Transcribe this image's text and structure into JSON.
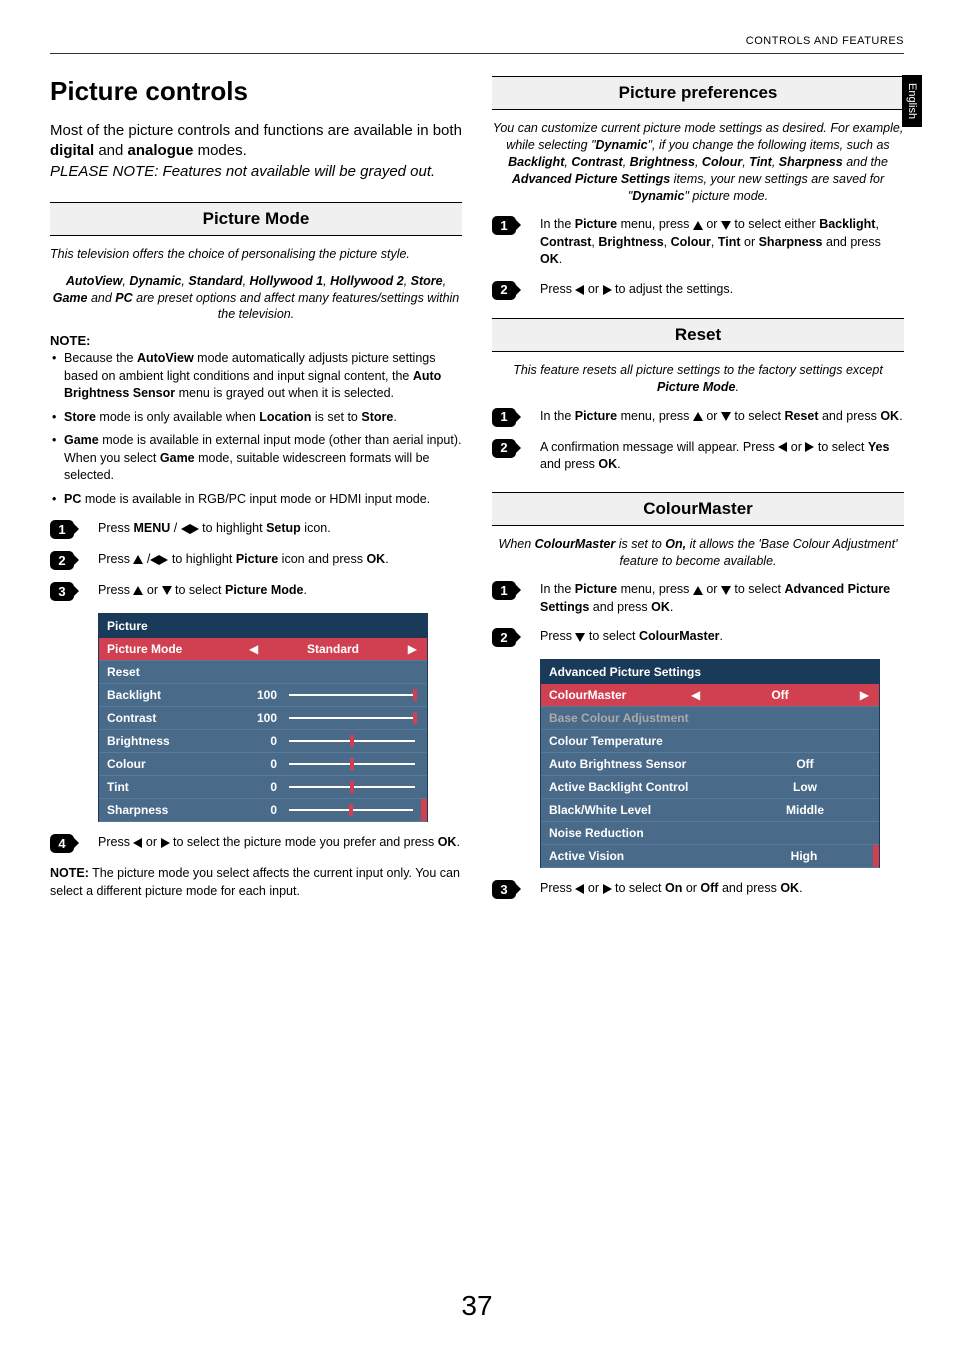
{
  "header": {
    "section_title": "CONTROLS AND FEATURES",
    "side_tab": "English"
  },
  "page_number": "37",
  "left": {
    "h1": "Picture controls",
    "intro_1": "Most of the picture controls and functions are available in both ",
    "intro_b1": "digital",
    "intro_2": " and ",
    "intro_b2": "analogue",
    "intro_3": " modes.",
    "intro_note": "PLEASE NOTE: Features not available will be grayed out.",
    "sec1_title": "Picture Mode",
    "sec1_sub": "This television offers the choice of personalising the picture style.",
    "sec1_desc_pre": "",
    "sec1_desc": "AutoView, Dynamic, Standard, Hollywood 1, Hollywood 2, Store, Game and PC are preset options and affect many features/settings within the television.",
    "note_label": "NOTE:",
    "notes": [
      "Because the AutoView mode automatically adjusts picture settings based on ambient light conditions and input signal content, the Auto Brightness Sensor menu is grayed out when it is selected.",
      "Store mode is only available when Location is set to Store.",
      "Game mode is available in external input mode (other than aerial input). When you select Game mode, suitable widescreen formats will be selected.",
      "PC mode is available in RGB/PC input mode or HDMI input mode."
    ],
    "step1": "Press MENU / ◀▶ to highlight Setup icon.",
    "step2": "Press ▲ /◀▶ to highlight Picture icon and press OK.",
    "step3": "Press ▲ or ▼ to select Picture Mode.",
    "step4": "Press ◀ or ▶ to select the picture mode you prefer and press OK.",
    "bottom_note": "NOTE: The picture mode you select affects the current input only. You can select a different picture mode for each input.",
    "menu": {
      "title": "Picture",
      "rows": [
        {
          "label": "Picture Mode",
          "value": "Standard",
          "type": "select",
          "active": true
        },
        {
          "label": "Reset",
          "type": "text"
        },
        {
          "label": "Backlight",
          "value": "100",
          "type": "slider",
          "pos": 100
        },
        {
          "label": "Contrast",
          "value": "100",
          "type": "slider",
          "pos": 100
        },
        {
          "label": "Brightness",
          "value": "0",
          "type": "slider",
          "pos": 50
        },
        {
          "label": "Colour",
          "value": "0",
          "type": "slider",
          "pos": 50
        },
        {
          "label": "Tint",
          "value": "0",
          "type": "slider",
          "pos": 50
        },
        {
          "label": "Sharpness",
          "value": "0",
          "type": "slider",
          "pos": 50,
          "scroll": true
        }
      ]
    }
  },
  "right": {
    "sec1_title": "Picture preferences",
    "sec1_sub": "You can customize current picture mode settings as desired. For example, while selecting \"Dynamic\", if you change the following items, such as Backlight, Contrast, Brightness, Colour, Tint, Sharpness and the Advanced Picture Settings items, your new settings are saved for \"Dynamic\" picture mode.",
    "sec1_step1": "In the Picture menu, press ▲ or ▼ to select either Backlight, Contrast, Brightness, Colour, Tint or Sharpness and press OK.",
    "sec1_step2": "Press ◀ or ▶ to adjust the settings.",
    "sec2_title": "Reset",
    "sec2_sub": "This feature resets all picture settings to the factory settings except Picture Mode.",
    "sec2_step1": "In the Picture menu, press ▲ or ▼ to select Reset and press OK.",
    "sec2_step2": "A confirmation message will appear. Press ◀ or ▶ to select Yes and press OK.",
    "sec3_title": "ColourMaster",
    "sec3_sub": "When ColourMaster is set to On, it allows the 'Base Colour Adjustment' feature to become available.",
    "sec3_step1": "In the Picture menu, press ▲ or ▼ to select Advanced Picture Settings and press OK.",
    "sec3_step2": "Press ▼ to select ColourMaster.",
    "sec3_step3": "Press ◀ or ▶ to select On or Off and press OK.",
    "menu": {
      "title": "Advanced Picture Settings",
      "rows": [
        {
          "label": "ColourMaster",
          "value": "Off",
          "type": "select",
          "active": true
        },
        {
          "label": "Base Colour Adjustment",
          "type": "text",
          "grayed": true
        },
        {
          "label": "Colour Temperature",
          "type": "text"
        },
        {
          "label": "Auto Brightness Sensor",
          "value": "Off",
          "type": "value"
        },
        {
          "label": "Active Backlight Control",
          "value": "Low",
          "type": "value"
        },
        {
          "label": "Black/White Level",
          "value": "Middle",
          "type": "value"
        },
        {
          "label": "Noise Reduction",
          "type": "text"
        },
        {
          "label": "Active Vision",
          "value": "High",
          "type": "value",
          "scroll": true
        }
      ]
    }
  }
}
